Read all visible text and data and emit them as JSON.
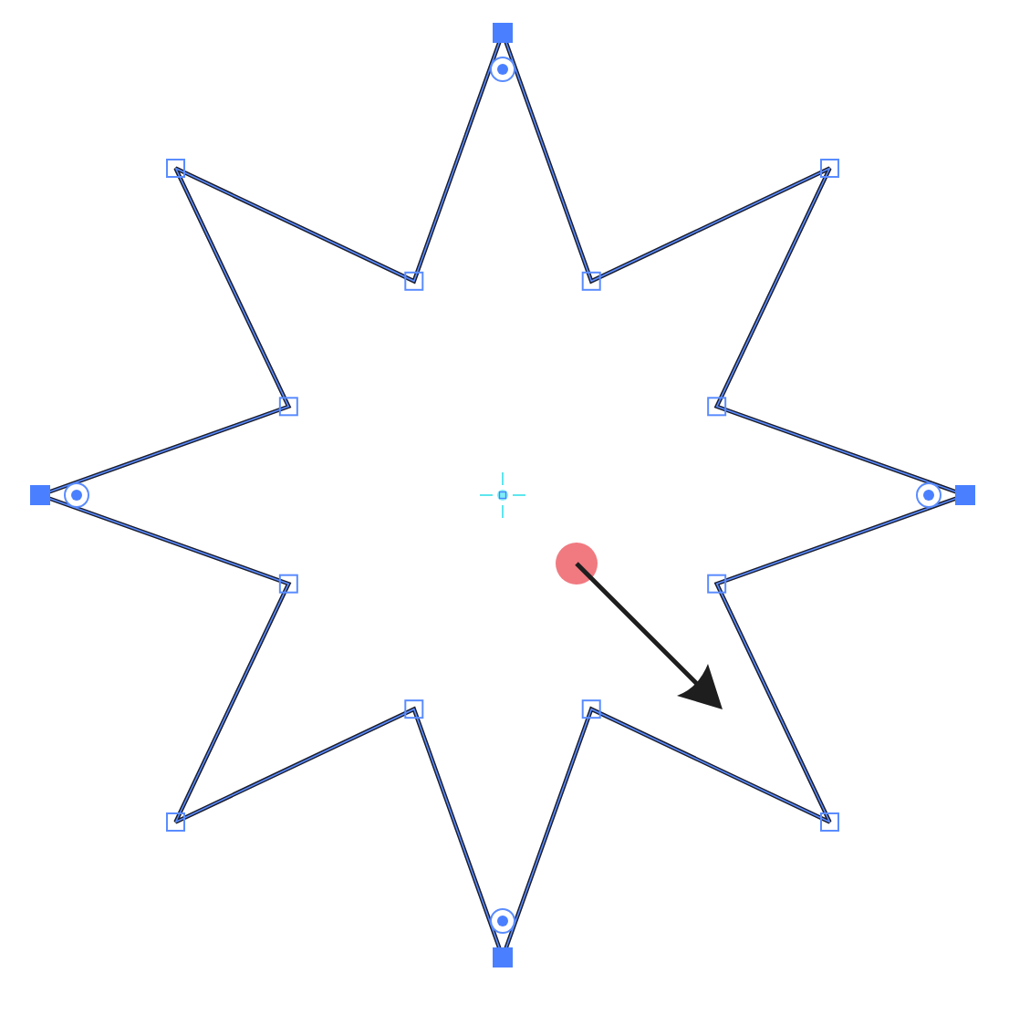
{
  "canvas": {
    "star": {
      "anchors": [
        {
          "selected": true
        },
        {
          "selected": false
        },
        {
          "selected": false
        },
        {
          "selected": false
        },
        {
          "selected": true
        },
        {
          "selected": false
        },
        {
          "selected": false
        },
        {
          "selected": false
        },
        {
          "selected": true
        },
        {
          "selected": false
        },
        {
          "selected": false
        },
        {
          "selected": false
        },
        {
          "selected": true
        },
        {
          "selected": false
        },
        {
          "selected": false
        },
        {
          "selected": false
        }
      ]
    }
  }
}
